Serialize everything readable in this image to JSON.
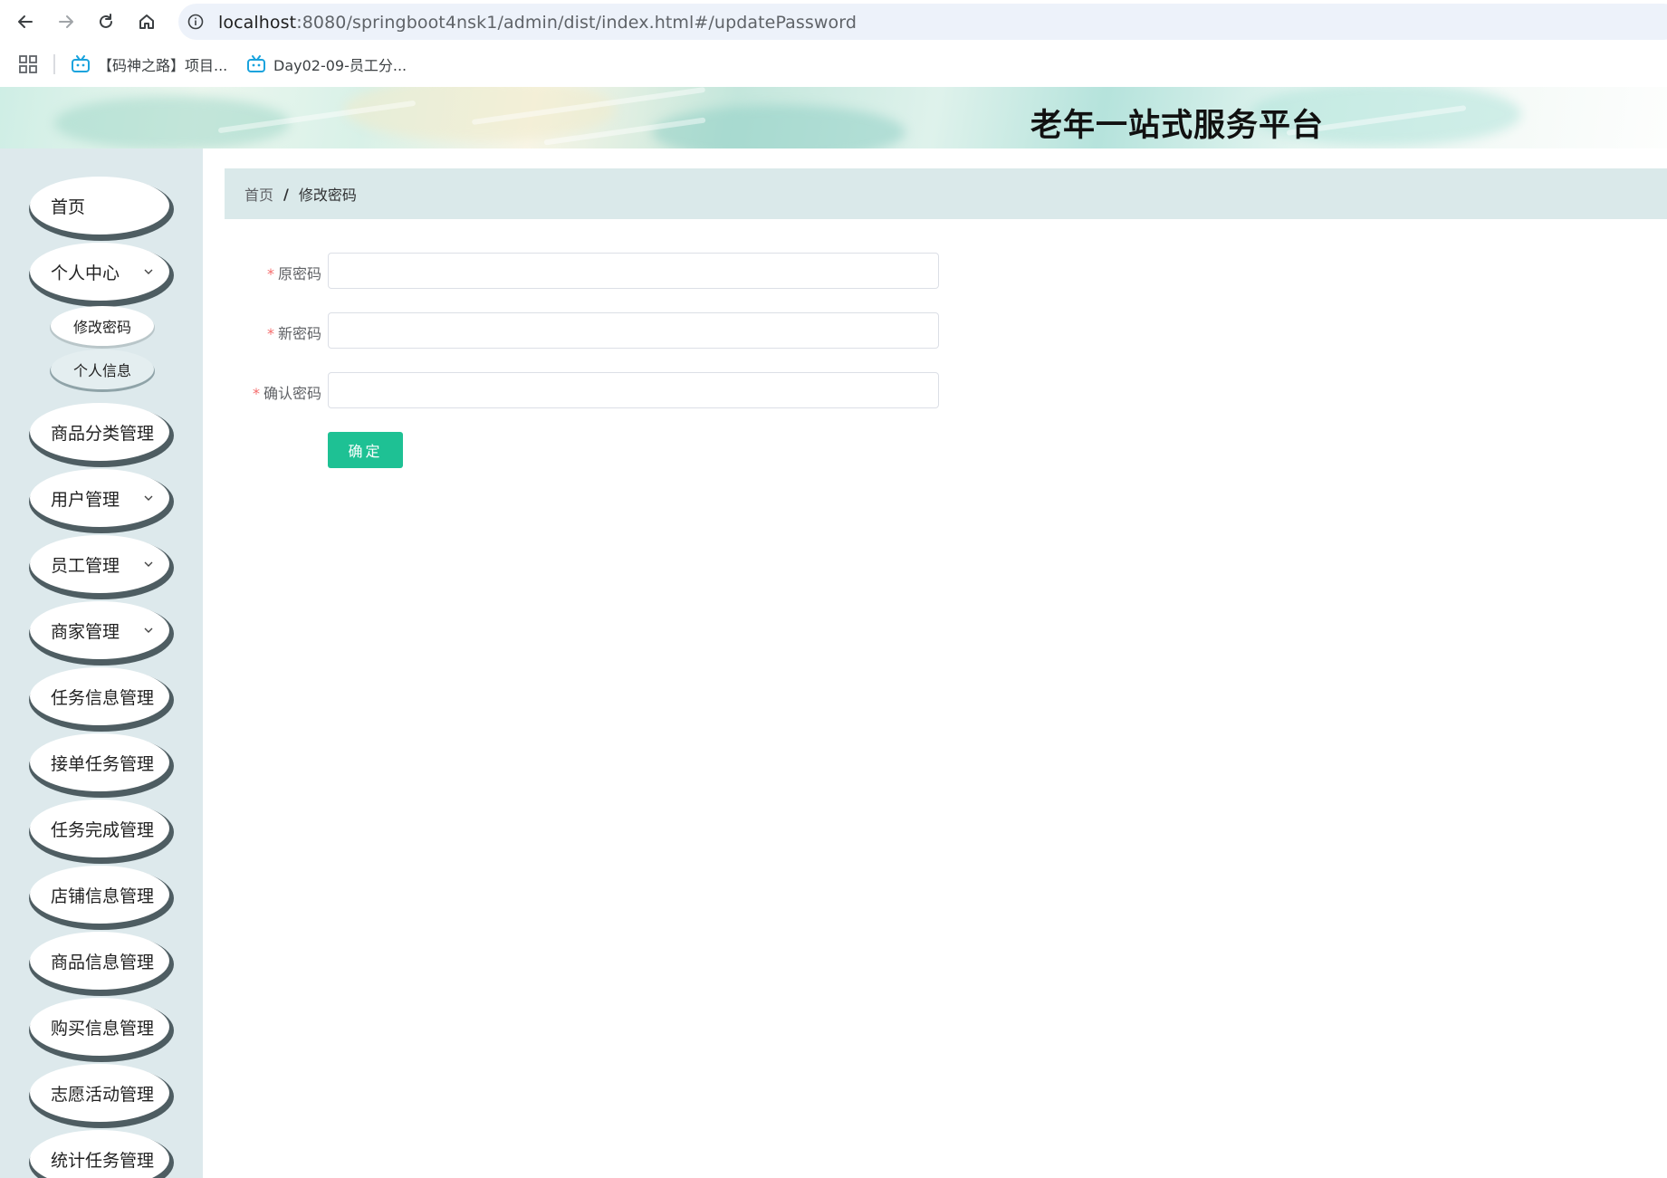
{
  "browser": {
    "url_host": "localhost",
    "url_path": ":8080/springboot4nsk1/admin/dist/index.html#/updatePassword",
    "bookmarks": [
      {
        "label": "【码神之路】项目...",
        "icon": "bilibili-tv-icon"
      },
      {
        "label": "Day02-09-员工分...",
        "icon": "bilibili-tv-icon"
      }
    ]
  },
  "header": {
    "title": "老年一站式服务平台"
  },
  "sidebar": {
    "items": [
      {
        "label": "首页",
        "has_children": false
      },
      {
        "label": "个人中心",
        "has_children": true,
        "expanded": true,
        "children": [
          {
            "label": "修改密码",
            "active": true
          },
          {
            "label": "个人信息",
            "active": false
          }
        ]
      },
      {
        "label": "商品分类管理",
        "has_children": true
      },
      {
        "label": "用户管理",
        "has_children": true
      },
      {
        "label": "员工管理",
        "has_children": true
      },
      {
        "label": "商家管理",
        "has_children": true
      },
      {
        "label": "任务信息管理",
        "has_children": true
      },
      {
        "label": "接单任务管理",
        "has_children": true
      },
      {
        "label": "任务完成管理",
        "has_children": true
      },
      {
        "label": "店铺信息管理",
        "has_children": true
      },
      {
        "label": "商品信息管理",
        "has_children": true
      },
      {
        "label": "购买信息管理",
        "has_children": true
      },
      {
        "label": "志愿活动管理",
        "has_children": true
      },
      {
        "label": "统计任务管理",
        "has_children": true
      }
    ]
  },
  "breadcrumb": {
    "home": "首页",
    "separator": "/",
    "current": "修改密码"
  },
  "form": {
    "required_mark": "*",
    "fields": [
      {
        "label": "原密码",
        "value": "",
        "placeholder": ""
      },
      {
        "label": "新密码",
        "value": "",
        "placeholder": ""
      },
      {
        "label": "确认密码",
        "value": "",
        "placeholder": ""
      }
    ],
    "submit_label": "确定"
  },
  "colors": {
    "sidebar_bg": "#dde9ec",
    "breadcrumb_bg": "#dae9ea",
    "primary_button": "#1ec194",
    "required_mark": "#f56c6c"
  }
}
